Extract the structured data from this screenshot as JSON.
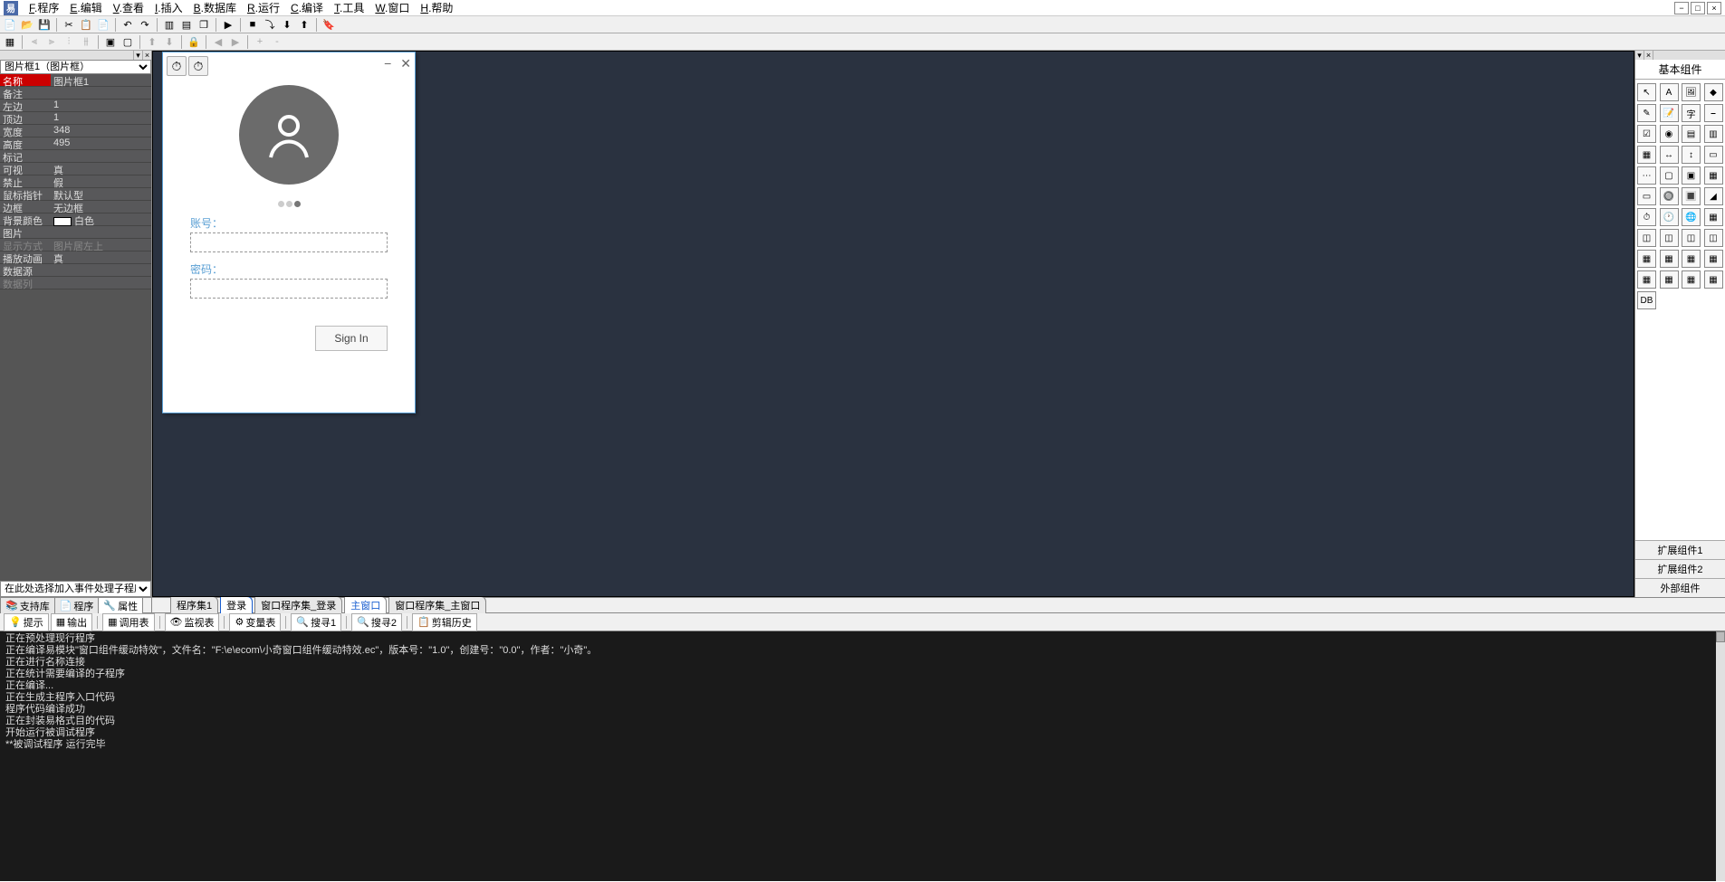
{
  "menu": {
    "items": [
      {
        "u": "F",
        "t": ".程序"
      },
      {
        "u": "E",
        "t": ".编辑"
      },
      {
        "u": "V",
        "t": ".查看"
      },
      {
        "u": "I",
        "t": ".插入"
      },
      {
        "u": "B",
        "t": ".数据库"
      },
      {
        "u": "R",
        "t": ".运行"
      },
      {
        "u": "C",
        "t": ".编译"
      },
      {
        "u": "T",
        "t": ".工具"
      },
      {
        "u": "W",
        "t": ".窗口"
      },
      {
        "u": "H",
        "t": ".帮助"
      }
    ]
  },
  "toolbar1": [
    "new-file",
    "open-file",
    "save-file",
    "|",
    "cut",
    "copy",
    "paste",
    "|",
    "undo",
    "redo",
    "|",
    "tile-h",
    "tile-v",
    "cascade",
    "|",
    "run",
    "|",
    "stop",
    "step",
    "step-into",
    "step-out",
    "|",
    "bookmark"
  ],
  "toolbar2": [
    "grid-toggle",
    "|",
    "align-left-g",
    "align-right-g",
    "align-top-g",
    "align-bottom-g",
    "|",
    "group",
    "ungroup",
    "|",
    "bring-front-g",
    "send-back-g",
    "|",
    "lock-g",
    "|",
    "prev-g",
    "next-g",
    "|",
    "zoom1-g",
    "zoom2-g"
  ],
  "left": {
    "selector": "图片框1（图片框）",
    "props": [
      {
        "k": "名称",
        "v": "图片框1",
        "sel": true
      },
      {
        "k": "备注",
        "v": ""
      },
      {
        "k": "左边",
        "v": "1"
      },
      {
        "k": "顶边",
        "v": "1"
      },
      {
        "k": "宽度",
        "v": "348"
      },
      {
        "k": "高度",
        "v": "495"
      },
      {
        "k": "标记",
        "v": ""
      },
      {
        "k": "可视",
        "v": "真"
      },
      {
        "k": "禁止",
        "v": "假"
      },
      {
        "k": "鼠标指针",
        "v": "默认型"
      },
      {
        "k": "边框",
        "v": "无边框"
      },
      {
        "k": "背景颜色",
        "v": "白色",
        "swatch": true
      },
      {
        "k": "图片",
        "v": ""
      },
      {
        "k": "显示方式",
        "v": "图片居左上",
        "grey": true
      },
      {
        "k": "播放动画",
        "v": "真"
      },
      {
        "k": "数据源",
        "v": ""
      },
      {
        "k": "数据列",
        "v": "",
        "grey": true
      }
    ],
    "event_prompt": "在此处选择加入事件处理子程序"
  },
  "login": {
    "account_label": "账号：",
    "password_label": "密码：",
    "signin": "Sign In"
  },
  "right": {
    "title": "基本组件",
    "ext1": "扩展组件1",
    "ext2": "扩展组件2",
    "ext3": "外部组件",
    "components": [
      "pointer",
      "label",
      "image",
      "shape",
      "edit",
      "memo",
      "letter",
      "line",
      "check",
      "radio",
      "list",
      "combo",
      "list2",
      "hscroll",
      "vscroll",
      "progress",
      "dots",
      "panel",
      "group",
      "frame",
      "tab",
      "button",
      "button2",
      "highlight",
      "timer",
      "clock",
      "net",
      "grid",
      "layout1",
      "layout2",
      "layout3",
      "layout4",
      "c33",
      "c34",
      "c35",
      "c36",
      "c37",
      "c38",
      "c39",
      "c40",
      "odbc"
    ]
  },
  "bottom_tabs_left": [
    {
      "label": "支持库",
      "icon": "📚"
    },
    {
      "label": "程序",
      "icon": "📄"
    },
    {
      "label": "属性",
      "icon": "🔧",
      "active": true
    }
  ],
  "bottom_tabs_right": [
    {
      "label": "程序集1"
    },
    {
      "label": "登录",
      "hl": true
    },
    {
      "label": "窗口程序集_登录"
    },
    {
      "label": "主窗口",
      "active": true
    },
    {
      "label": "窗口程序集_主窗口"
    }
  ],
  "out_toolbar": [
    {
      "icon": "💡",
      "label": "提示"
    },
    {
      "icon": "▦",
      "label": "输出"
    },
    "|",
    {
      "icon": "▦",
      "label": "调用表"
    },
    "|",
    {
      "icon": "👁",
      "label": "监视表"
    },
    "|",
    {
      "icon": "⚙",
      "label": "变量表"
    },
    "|",
    {
      "icon": "🔍",
      "label": "搜寻1"
    },
    "|",
    {
      "icon": "🔍",
      "label": "搜寻2"
    },
    "|",
    {
      "icon": "📋",
      "label": "剪辑历史"
    }
  ],
  "console": [
    "正在预处理现行程序",
    "正在编译易模块\"窗口组件缓动特效\"，文件名：\"F:\\e\\ecom\\小奇窗口组件缓动特效.ec\"，版本号：\"1.0\"，创建号：\"0.0\"，作者：\"小奇\"。",
    "正在进行名称连接",
    "正在统计需要编译的子程序",
    "正在编译...",
    "正在生成主程序入口代码",
    "程序代码编译成功",
    "正在封装易格式目的代码",
    "开始运行被调试程序",
    "**被调试程序 运行完毕"
  ]
}
